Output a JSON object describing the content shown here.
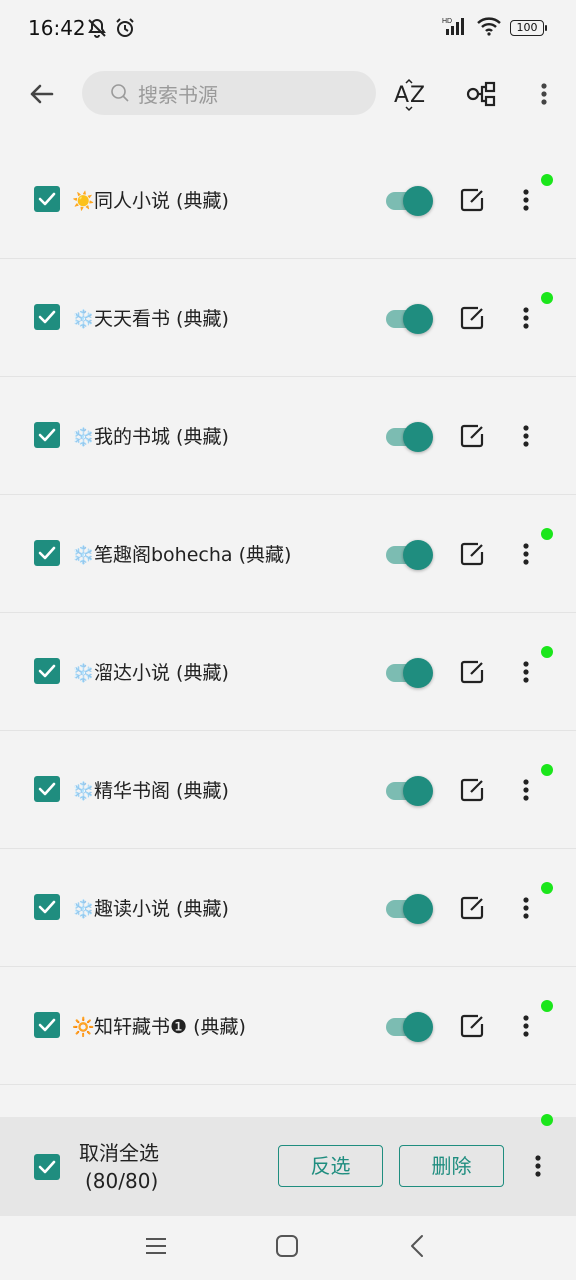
{
  "status_bar": {
    "time": "16:42",
    "battery": "100",
    "icons": [
      "mute-bell-icon",
      "alarm-icon",
      "signal-icon",
      "wifi-icon",
      "battery-icon"
    ]
  },
  "toolbar": {
    "search_placeholder": "搜索书源",
    "icons": [
      "back-arrow-icon",
      "sort-az-icon",
      "group-icon",
      "more-vertical-icon"
    ]
  },
  "sources": [
    {
      "icon": "☀️",
      "name": "同人小说 (典藏)",
      "enabled": true,
      "selected": true,
      "updated": true
    },
    {
      "icon": "❄️",
      "name": "天天看书 (典藏)",
      "enabled": true,
      "selected": true,
      "updated": true
    },
    {
      "icon": "❄️",
      "name": "我的书城 (典藏)",
      "enabled": true,
      "selected": true,
      "updated": false
    },
    {
      "icon": "❄️",
      "name": "笔趣阁bohecha (典藏)",
      "enabled": true,
      "selected": true,
      "updated": true
    },
    {
      "icon": "❄️",
      "name": "溜达小说 (典藏)",
      "enabled": true,
      "selected": true,
      "updated": true
    },
    {
      "icon": "❄️",
      "name": "精华书阁 (典藏)",
      "enabled": true,
      "selected": true,
      "updated": true
    },
    {
      "icon": "❄️",
      "name": "趣读小说 (典藏)",
      "enabled": true,
      "selected": true,
      "updated": true
    },
    {
      "icon": "🔆",
      "name": "知轩藏书❶ (典藏)",
      "enabled": true,
      "selected": true,
      "updated": true
    }
  ],
  "bottom_bar": {
    "select_label": "取消全选",
    "select_count": "(80/80)",
    "invert_label": "反选",
    "delete_label": "删除"
  },
  "colors": {
    "accent": "#1f8d7f",
    "switch_track": "#7cbcb2",
    "update_dot": "#1be61b"
  }
}
